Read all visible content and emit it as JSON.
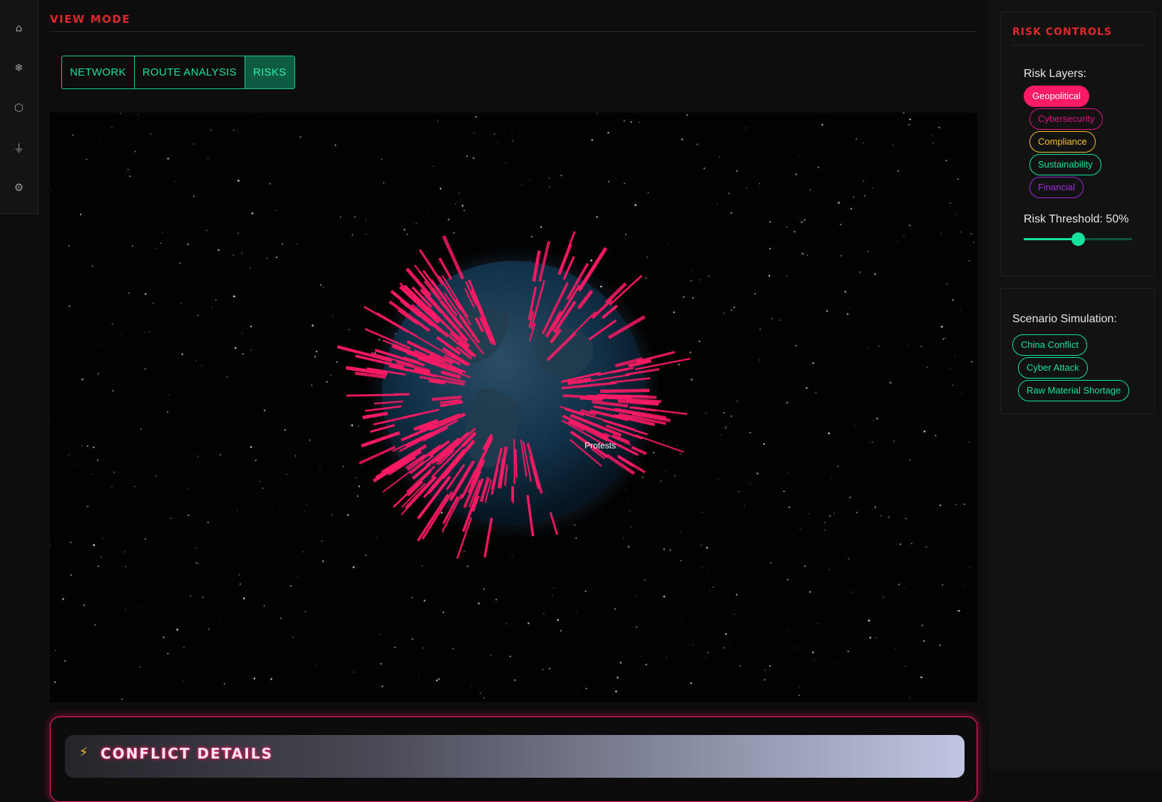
{
  "nav": {
    "items": [
      {
        "name": "home-icon",
        "glyph": "⌂"
      },
      {
        "name": "snowflake-icon",
        "glyph": "❄"
      },
      {
        "name": "hexagon-icon",
        "glyph": "⬡"
      },
      {
        "name": "ground-icon",
        "glyph": "⏚"
      },
      {
        "name": "gear-icon",
        "glyph": "⚙"
      }
    ]
  },
  "view_mode": {
    "title": "VIEW MODE",
    "tabs": [
      {
        "label": "NETWORK",
        "active": false
      },
      {
        "label": "ROUTE ANALYSIS",
        "active": false
      },
      {
        "label": "RISKS",
        "active": true
      }
    ]
  },
  "globe": {
    "hover_label": "Protests",
    "risk_color": "#ff1a66",
    "ocean_color": "#0f2a3d"
  },
  "conflict": {
    "icon": "⚡",
    "title": "CONFLICT DETAILS"
  },
  "risk_controls": {
    "title": "RISK CONTROLS",
    "layers_label": "Risk Layers:",
    "layers": [
      {
        "label": "Geopolitical",
        "color": "#ff1a66",
        "active": true
      },
      {
        "label": "Cybersecurity",
        "color": "#e0157f",
        "active": false
      },
      {
        "label": "Compliance",
        "color": "#f5c030",
        "active": false
      },
      {
        "label": "Sustainability",
        "color": "#17e39b",
        "active": false
      },
      {
        "label": "Financial",
        "color": "#a326e0",
        "active": false
      }
    ],
    "threshold_label": "Risk Threshold: 50%",
    "threshold_value": 0.5
  },
  "scenario": {
    "label": "Scenario Simulation:",
    "items": [
      {
        "label": "China Conflict"
      },
      {
        "label": "Cyber Attack"
      },
      {
        "label": "Raw Material Shortage"
      }
    ],
    "color": "#17e39b"
  }
}
